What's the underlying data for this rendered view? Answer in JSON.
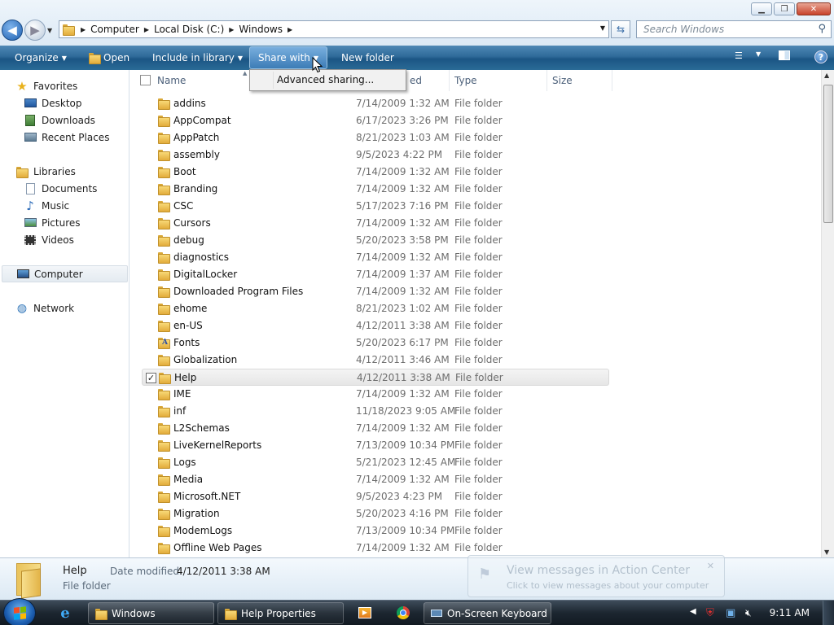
{
  "window": {
    "minimize": "▁",
    "maximize": "❐",
    "close": "✕"
  },
  "address": {
    "crumbs": [
      "Computer",
      "Local Disk (C:)",
      "Windows"
    ],
    "search_placeholder": "Search Windows"
  },
  "toolbar": {
    "organize": "Organize",
    "open": "Open",
    "include_in_library": "Include in library",
    "share_with": "Share with",
    "new_folder": "New folder",
    "help": "?"
  },
  "share_menu": {
    "advanced_sharing": "Advanced sharing..."
  },
  "nav": {
    "favorites": "Favorites",
    "desktop": "Desktop",
    "downloads": "Downloads",
    "recent_places": "Recent Places",
    "libraries": "Libraries",
    "documents": "Documents",
    "music": "Music",
    "pictures": "Pictures",
    "videos": "Videos",
    "computer": "Computer",
    "network": "Network"
  },
  "columns": {
    "name": "Name",
    "date_modified_visible": "ed",
    "type": "Type",
    "size": "Size"
  },
  "files": [
    {
      "name": "addins",
      "date": "7/14/2009 1:32 AM",
      "type": "File folder"
    },
    {
      "name": "AppCompat",
      "date": "6/17/2023 3:26 PM",
      "type": "File folder"
    },
    {
      "name": "AppPatch",
      "date": "8/21/2023 1:03 AM",
      "type": "File folder"
    },
    {
      "name": "assembly",
      "date": "9/5/2023 4:22 PM",
      "type": "File folder"
    },
    {
      "name": "Boot",
      "date": "7/14/2009 1:32 AM",
      "type": "File folder"
    },
    {
      "name": "Branding",
      "date": "7/14/2009 1:32 AM",
      "type": "File folder"
    },
    {
      "name": "CSC",
      "date": "5/17/2023 7:16 PM",
      "type": "File folder"
    },
    {
      "name": "Cursors",
      "date": "7/14/2009 1:32 AM",
      "type": "File folder"
    },
    {
      "name": "debug",
      "date": "5/20/2023 3:58 PM",
      "type": "File folder"
    },
    {
      "name": "diagnostics",
      "date": "7/14/2009 1:32 AM",
      "type": "File folder"
    },
    {
      "name": "DigitalLocker",
      "date": "7/14/2009 1:37 AM",
      "type": "File folder"
    },
    {
      "name": "Downloaded Program Files",
      "date": "7/14/2009 1:32 AM",
      "type": "File folder"
    },
    {
      "name": "ehome",
      "date": "8/21/2023 1:02 AM",
      "type": "File folder"
    },
    {
      "name": "en-US",
      "date": "4/12/2011 3:38 AM",
      "type": "File folder"
    },
    {
      "name": "Fonts",
      "date": "5/20/2023 6:17 PM",
      "type": "File folder",
      "special": "fonts"
    },
    {
      "name": "Globalization",
      "date": "4/12/2011 3:46 AM",
      "type": "File folder"
    },
    {
      "name": "Help",
      "date": "4/12/2011 3:38 AM",
      "type": "File folder",
      "selected": true
    },
    {
      "name": "IME",
      "date": "7/14/2009 1:32 AM",
      "type": "File folder"
    },
    {
      "name": "inf",
      "date": "11/18/2023 9:05 AM",
      "type": "File folder"
    },
    {
      "name": "L2Schemas",
      "date": "7/14/2009 1:32 AM",
      "type": "File folder"
    },
    {
      "name": "LiveKernelReports",
      "date": "7/13/2009 10:34 PM",
      "type": "File folder"
    },
    {
      "name": "Logs",
      "date": "5/21/2023 12:45 AM",
      "type": "File folder"
    },
    {
      "name": "Media",
      "date": "7/14/2009 1:32 AM",
      "type": "File folder"
    },
    {
      "name": "Microsoft.NET",
      "date": "9/5/2023 4:23 PM",
      "type": "File folder"
    },
    {
      "name": "Migration",
      "date": "5/20/2023 4:16 PM",
      "type": "File folder"
    },
    {
      "name": "ModemLogs",
      "date": "7/13/2009 10:34 PM",
      "type": "File folder"
    },
    {
      "name": "Offline Web Pages",
      "date": "7/14/2009 1:32 AM",
      "type": "File folder"
    }
  ],
  "details": {
    "name": "Help",
    "type": "File folder",
    "date_label": "Date modified:",
    "date_value": "4/12/2011 3:38 AM"
  },
  "toast": {
    "title": "View messages in Action Center",
    "subtitle": "Click to view messages about your computer",
    "close": "✕"
  },
  "taskbar": {
    "windows_explorer": "Windows",
    "help_properties": "Help Properties",
    "on_screen_keyboard": "On-Screen Keyboard",
    "clock": "9:11 AM"
  },
  "colors": {
    "command_bar": "#2e6a99",
    "selection": "#e6e6e6",
    "taskbar": "#1c2630"
  }
}
